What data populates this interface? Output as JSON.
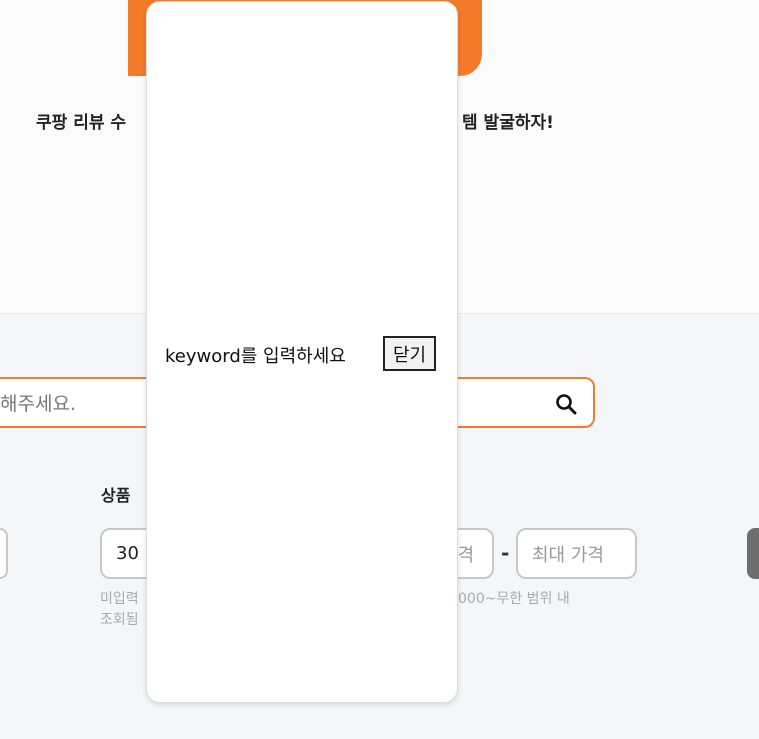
{
  "hero": {
    "tagline_left": "쿠팡 리뷰 수",
    "tagline_right": "템 발굴하자!"
  },
  "search": {
    "text": "해주세요.",
    "icon": "search-icon"
  },
  "filters": {
    "section_label": "상품",
    "review_input_value": "30",
    "min_price_placeholder": "격",
    "max_price_placeholder": "최대 가격",
    "dash": "-",
    "hint1_line1": "미입력",
    "hint1_line2": "조회됨",
    "hint2": "000~무한 범위 내"
  },
  "modal": {
    "message": "keyword를 입력하세요",
    "close_label": "닫기"
  },
  "colors": {
    "accent": "#f47a2a",
    "page_bg": "#f4f6f9"
  }
}
